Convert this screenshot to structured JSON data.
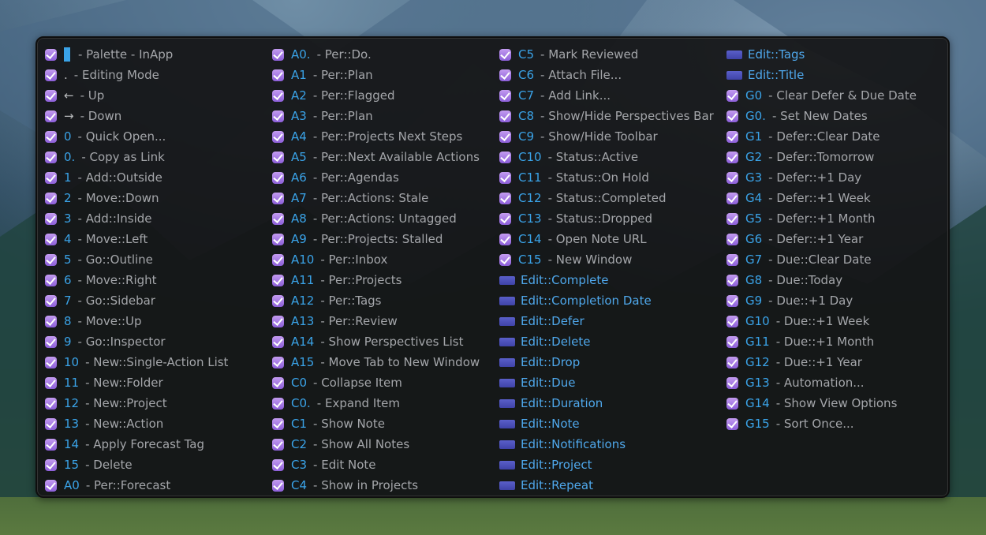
{
  "columns": [
    [
      {
        "key": "",
        "label": " -  Palette - InApp",
        "cursor": true
      },
      {
        "key": ".",
        "label": " - Editing Mode"
      },
      {
        "key": "←",
        "label": " - Up"
      },
      {
        "key": "→",
        "label": " - Down"
      },
      {
        "key": "0",
        "label": " - Quick Open..."
      },
      {
        "key": "0.",
        "label": " - Copy as Link"
      },
      {
        "key": "1",
        "label": " - Add::Outside"
      },
      {
        "key": "2",
        "label": " - Move::Down"
      },
      {
        "key": "3",
        "label": " - Add::Inside"
      },
      {
        "key": "4",
        "label": " - Move::Left"
      },
      {
        "key": "5",
        "label": " - Go::Outline"
      },
      {
        "key": "6",
        "label": " - Move::Right"
      },
      {
        "key": "7",
        "label": " - Go::Sidebar"
      },
      {
        "key": "8",
        "label": " - Move::Up"
      },
      {
        "key": "9",
        "label": " - Go::Inspector"
      },
      {
        "key": "10",
        "label": " - New::Single-Action List"
      },
      {
        "key": "11",
        "label": " - New::Folder"
      },
      {
        "key": "12",
        "label": " - New::Project"
      },
      {
        "key": "13",
        "label": " - New::Action"
      },
      {
        "key": "14",
        "label": " - Apply Forecast Tag"
      },
      {
        "key": "15",
        "label": " - Delete"
      },
      {
        "key": "A0",
        "label": " - Per::Forecast"
      }
    ],
    [
      {
        "key": "A0.",
        "label": " - Per::Do."
      },
      {
        "key": "A1",
        "label": " - Per::Plan"
      },
      {
        "key": "A2",
        "label": " - Per::Flagged"
      },
      {
        "key": "A3",
        "label": " - Per::Plan"
      },
      {
        "key": "A4",
        "label": " - Per::Projects Next Steps"
      },
      {
        "key": "A5",
        "label": " - Per::Next Available Actions"
      },
      {
        "key": "A6",
        "label": " - Per::Agendas"
      },
      {
        "key": "A7",
        "label": " - Per::Actions: Stale"
      },
      {
        "key": "A8",
        "label": " - Per::Actions: Untagged"
      },
      {
        "key": "A9",
        "label": " - Per::Projects: Stalled"
      },
      {
        "key": "A10",
        "label": " - Per::Inbox"
      },
      {
        "key": "A11",
        "label": " - Per::Projects"
      },
      {
        "key": "A12",
        "label": " - Per::Tags"
      },
      {
        "key": "A13",
        "label": " - Per::Review"
      },
      {
        "key": "A14",
        "label": " - Show Perspectives List"
      },
      {
        "key": "A15",
        "label": " - Move Tab to New Window"
      },
      {
        "key": "C0",
        "label": " - Collapse Item"
      },
      {
        "key": "C0.",
        "label": " - Expand Item"
      },
      {
        "key": "C1",
        "label": " - Show Note"
      },
      {
        "key": "C2",
        "label": " - Show All Notes"
      },
      {
        "key": "C3",
        "label": " - Edit Note"
      },
      {
        "key": "C4",
        "label": " - Show in Projects"
      }
    ],
    [
      {
        "key": "C5",
        "label": " - Mark Reviewed"
      },
      {
        "key": "C6",
        "label": " - Attach File..."
      },
      {
        "key": "C7",
        "label": " - Add Link..."
      },
      {
        "key": "C8",
        "label": " - Show/Hide Perspectives Bar"
      },
      {
        "key": "C9",
        "label": " - Show/Hide Toolbar"
      },
      {
        "key": "C10",
        "label": " - Status::Active"
      },
      {
        "key": "C11",
        "label": " - Status::On Hold"
      },
      {
        "key": "C12",
        "label": " - Status::Completed"
      },
      {
        "key": "C13",
        "label": " - Status::Dropped"
      },
      {
        "key": "C14",
        "label": " - Open Note URL"
      },
      {
        "key": "C15",
        "label": " - New Window"
      },
      {
        "edit": "Edit::Complete"
      },
      {
        "edit": "Edit::Completion Date"
      },
      {
        "edit": "Edit::Defer"
      },
      {
        "edit": "Edit::Delete"
      },
      {
        "edit": "Edit::Drop"
      },
      {
        "edit": "Edit::Due"
      },
      {
        "edit": "Edit::Duration"
      },
      {
        "edit": "Edit::Note"
      },
      {
        "edit": "Edit::Notifications"
      },
      {
        "edit": "Edit::Project"
      },
      {
        "edit": "Edit::Repeat"
      }
    ],
    [
      {
        "edit": "Edit::Tags"
      },
      {
        "edit": "Edit::Title"
      },
      {
        "key": "G0",
        "label": " - Clear Defer & Due Date"
      },
      {
        "key": "G0.",
        "label": " - Set New Dates"
      },
      {
        "key": "G1",
        "label": " - Defer::Clear Date"
      },
      {
        "key": "G2",
        "label": " - Defer::Tomorrow"
      },
      {
        "key": "G3",
        "label": " - Defer::+1 Day"
      },
      {
        "key": "G4",
        "label": " - Defer::+1 Week"
      },
      {
        "key": "G5",
        "label": " - Defer::+1 Month"
      },
      {
        "key": "G6",
        "label": " - Defer::+1 Year"
      },
      {
        "key": "G7",
        "label": " - Due::Clear Date"
      },
      {
        "key": "G8",
        "label": " - Due::Today"
      },
      {
        "key": "G9",
        "label": " - Due::+1 Day"
      },
      {
        "key": "G10",
        "label": " - Due::+1 Week"
      },
      {
        "key": "G11",
        "label": " - Due::+1 Month"
      },
      {
        "key": "G12",
        "label": " - Due::+1 Year"
      },
      {
        "key": "G13",
        "label": " - Automation..."
      },
      {
        "key": "G14",
        "label": " - Show View Options"
      },
      {
        "key": "G15",
        "label": " - Sort Once..."
      }
    ]
  ],
  "icons": {
    "check": "checkbox-checked-icon",
    "edit": "edit-action-icon"
  },
  "colors": {
    "accent": "#3aa3e8",
    "check": "#a97de8",
    "panel": "#161618"
  }
}
